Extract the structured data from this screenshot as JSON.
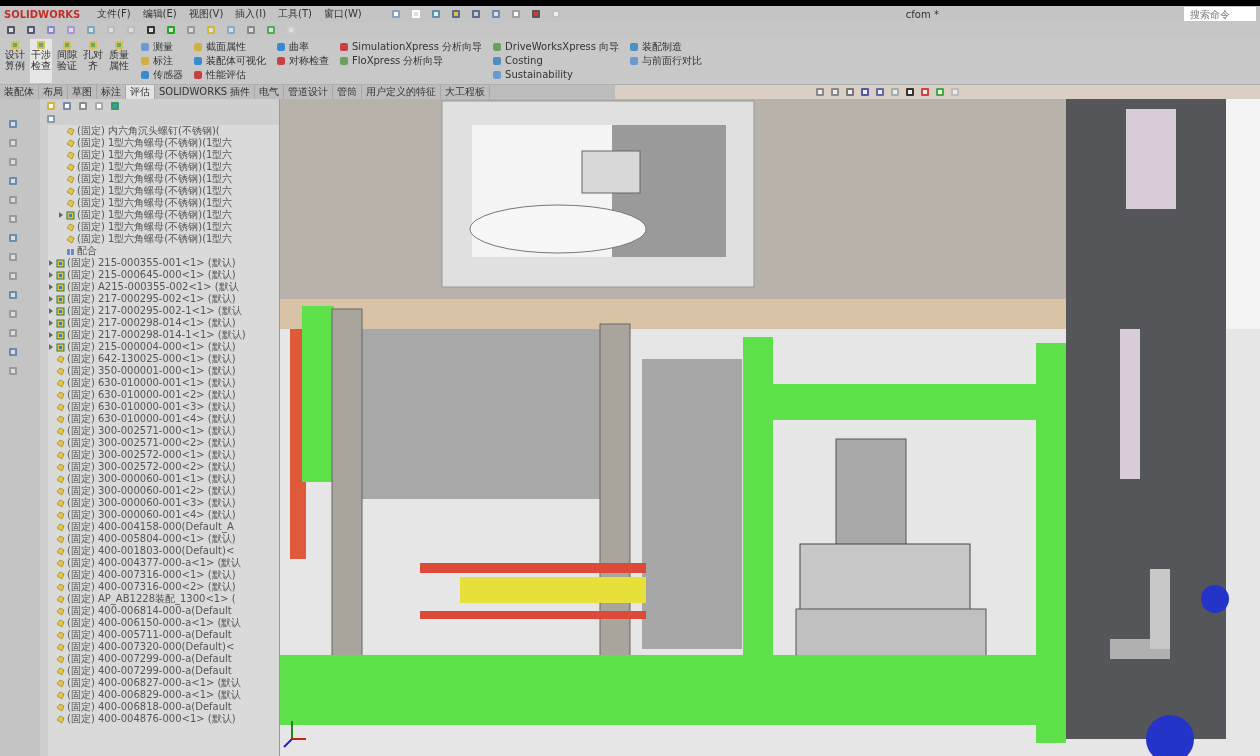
{
  "app": {
    "logo": "SOLIDWORKS",
    "title": "cfom *",
    "search": {
      "placeholder": "搜索命令"
    }
  },
  "menu": [
    "文件(F)",
    "编辑(E)",
    "视图(V)",
    "插入(I)",
    "工具(T)",
    "窗口(W)"
  ],
  "ribbon": {
    "large_buttons": [
      {
        "label": "设计算例",
        "selected": false
      },
      {
        "label": "干涉检查",
        "selected": true
      },
      {
        "label": "间隙验证",
        "selected": false
      },
      {
        "label": "孔对齐",
        "selected": false
      },
      {
        "label": "质量属性",
        "selected": false
      }
    ],
    "columns": [
      [
        "测量",
        "标注",
        "传感器"
      ],
      [
        "截面属性",
        "装配体可视化",
        "性能评估"
      ],
      [
        "曲率",
        "对称检查"
      ],
      [
        "SimulationXpress 分析向导",
        "FloXpress 分析向导"
      ],
      [
        "DriveWorksXpress 向导",
        "Costing",
        "Sustainability"
      ],
      [
        "装配制造",
        "与前面行对比"
      ]
    ]
  },
  "tabs": [
    {
      "label": "装配体",
      "selected": false
    },
    {
      "label": "布局",
      "selected": false
    },
    {
      "label": "草图",
      "selected": false
    },
    {
      "label": "标注",
      "selected": false
    },
    {
      "label": "评估",
      "selected": true
    },
    {
      "label": "SOLIDWORKS 插件",
      "selected": false
    },
    {
      "label": "电气",
      "selected": false
    },
    {
      "label": "管道设计",
      "selected": false
    },
    {
      "label": "管筒",
      "selected": false
    },
    {
      "label": "用户定义的特征",
      "selected": false
    },
    {
      "label": "大工程板",
      "selected": false
    }
  ],
  "tree": {
    "children": [
      {
        "label": "(固定) 内六角沉头螺钉(不锈钢)(",
        "kind": "part"
      },
      {
        "label": "(固定) 1型六角螺母(不锈钢)(1型六",
        "kind": "part"
      },
      {
        "label": "(固定) 1型六角螺母(不锈钢)(1型六",
        "kind": "part"
      },
      {
        "label": "(固定) 1型六角螺母(不锈钢)(1型六",
        "kind": "part"
      },
      {
        "label": "(固定) 1型六角螺母(不锈钢)(1型六",
        "kind": "part"
      },
      {
        "label": "(固定) 1型六角螺母(不锈钢)(1型六",
        "kind": "part"
      },
      {
        "label": "(固定) 1型六角螺母(不锈钢)(1型六",
        "kind": "part"
      },
      {
        "label": "(固定) 1型六角螺母(不锈钢)(1型六",
        "kind": "assembly",
        "expanded": false
      },
      {
        "label": "(固定) 1型六角螺母(不锈钢)(1型六",
        "kind": "part"
      },
      {
        "label": "(固定) 1型六角螺母(不锈钢)(1型六",
        "kind": "part"
      },
      {
        "label": "配合",
        "kind": "mates"
      }
    ],
    "items": [
      {
        "label": "(固定) 215-000355-001<1> (默认)",
        "kind": "assembly",
        "expanded": false
      },
      {
        "label": "(固定) 215-000645-000<1> (默认)",
        "kind": "assembly",
        "expanded": false
      },
      {
        "label": "(固定) A215-000355-002<1> (默认",
        "kind": "assembly",
        "expanded": false
      },
      {
        "label": "(固定) 217-000295-002<1> (默认)",
        "kind": "assembly",
        "expanded": false
      },
      {
        "label": "(固定) 217-000295-002-1<1> (默认",
        "kind": "assembly",
        "expanded": false
      },
      {
        "label": "(固定) 217-000298-014<1> (默认)",
        "kind": "assembly",
        "expanded": false
      },
      {
        "label": "(固定) 217-000298-014-1<1> (默认)",
        "kind": "assembly",
        "expanded": false
      },
      {
        "label": "(固定) 215-000004-000<1> (默认)",
        "kind": "assembly",
        "expanded": false
      },
      {
        "label": "(固定) 642-130025-000<1> (默认)",
        "kind": "part"
      },
      {
        "label": "(固定) 350-000001-000<1> (默认)",
        "kind": "part"
      },
      {
        "label": "(固定) 630-010000-001<1> (默认)",
        "kind": "part"
      },
      {
        "label": "(固定) 630-010000-001<2> (默认)",
        "kind": "part"
      },
      {
        "label": "(固定) 630-010000-001<3> (默认)",
        "kind": "part"
      },
      {
        "label": "(固定) 630-010000-001<4> (默认)",
        "kind": "part"
      },
      {
        "label": "(固定) 300-002571-000<1> (默认)",
        "kind": "part"
      },
      {
        "label": "(固定) 300-002571-000<2> (默认)",
        "kind": "part"
      },
      {
        "label": "(固定) 300-002572-000<1> (默认)",
        "kind": "part"
      },
      {
        "label": "(固定) 300-002572-000<2> (默认)",
        "kind": "part"
      },
      {
        "label": "(固定) 300-000060-001<1> (默认)",
        "kind": "part"
      },
      {
        "label": "(固定) 300-000060-001<2> (默认)",
        "kind": "part"
      },
      {
        "label": "(固定) 300-000060-001<3> (默认)",
        "kind": "part"
      },
      {
        "label": "(固定) 300-000060-001<4> (默认)",
        "kind": "part"
      },
      {
        "label": "(固定) 400-004158-000(Default_A",
        "kind": "part"
      },
      {
        "label": "(固定) 400-005804-000<1> (默认)",
        "kind": "part"
      },
      {
        "label": "(固定) 400-001803-000(Default)<",
        "kind": "part"
      },
      {
        "label": "(固定) 400-004377-000-a<1> (默认",
        "kind": "part"
      },
      {
        "label": "(固定) 400-007316-000<1> (默认)",
        "kind": "part"
      },
      {
        "label": "(固定) 400-007316-000<2> (默认)",
        "kind": "part"
      },
      {
        "label": "(固定) AP_AB1228装配_1300<1> (",
        "kind": "part"
      },
      {
        "label": "(固定) 400-006814-000-a(Default",
        "kind": "part"
      },
      {
        "label": "(固定) 400-006150-000-a<1> (默认",
        "kind": "part"
      },
      {
        "label": "(固定) 400-005711-000-a(Default",
        "kind": "part"
      },
      {
        "label": "(固定) 400-007320-000(Default)<",
        "kind": "part"
      },
      {
        "label": "(固定) 400-007299-000-a(Default",
        "kind": "part"
      },
      {
        "label": "(固定) 400-007299-000-a(Default",
        "kind": "part"
      },
      {
        "label": "(固定) 400-006827-000-a<1> (默认",
        "kind": "part"
      },
      {
        "label": "(固定) 400-006829-000-a<1> (默认",
        "kind": "part"
      },
      {
        "label": "(固定) 400-006818-000-a(Default",
        "kind": "part"
      },
      {
        "label": "(固定) 400-004876-000<1> (默认)",
        "kind": "part"
      }
    ]
  }
}
